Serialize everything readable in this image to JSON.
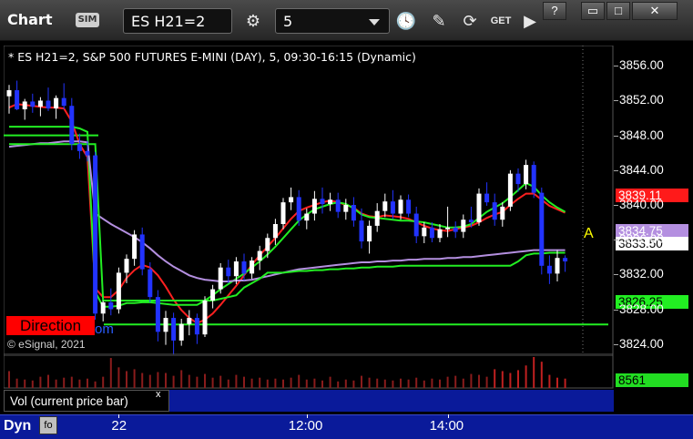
{
  "window": {
    "title": "Chart",
    "sim_badge": "SIM",
    "symbol": "ES H21=2",
    "interval": "5",
    "buttons": [
      "clock-icon",
      "pencil-icon",
      "study-icon",
      "get-icon",
      "play-icon",
      "question-icon",
      "restore-icon",
      "maximize-icon",
      "close-icon"
    ],
    "get_label": "GET"
  },
  "chart_info": "* ES H21=2, S&P 500 FUTURES E-MINI (DAY), 5, 09:30-16:15 (Dynamic)",
  "copyright": "© eSignal, 2021",
  "direction_label": "Direction",
  "direction_tail": "om",
  "marker_label": "A",
  "volume_pane": {
    "label": "Vol (current price bar)",
    "close": "x",
    "last": "8561"
  },
  "footer": {
    "mode": "Dyn",
    "icon_label": "fo"
  },
  "price_badges": {
    "red": "3839.11",
    "purple": "3834.75",
    "white": "3833.50",
    "green": "3826.25"
  },
  "colors": {
    "up_candle": "#ffffff",
    "down_candle": "#2233ff",
    "red_ma": "#ff2020",
    "green_ma": "#22ee22",
    "purple_ma": "#b48fe0",
    "support_line": "#22ee22",
    "volume": "#8a1c1c",
    "panel_blue": "#0a1a9a"
  },
  "chart_data": {
    "type": "candlestick",
    "y_ticks": [
      "3856.00",
      "3852.00",
      "3848.00",
      "3844.00",
      "3840.00",
      "3836.00",
      "3832.00",
      "3828.00",
      "3824.00"
    ],
    "ylim": [
      3822.5,
      3857.5
    ],
    "x_ticks": [
      "22",
      "12:00",
      "14:00"
    ],
    "x_tick_index": [
      14,
      38,
      56
    ],
    "candles": [
      [
        3852.5,
        3853.8,
        3850.5,
        3853.2
      ],
      [
        3853.2,
        3854.3,
        3850.9,
        3851.0
      ],
      [
        3851.0,
        3852.2,
        3849.8,
        3851.9
      ],
      [
        3851.9,
        3852.8,
        3850.6,
        3851.3
      ],
      [
        3851.3,
        3852.4,
        3850.2,
        3852.0
      ],
      [
        3852.0,
        3853.5,
        3850.8,
        3851.1
      ],
      [
        3851.1,
        3852.6,
        3849.9,
        3852.3
      ],
      [
        3852.3,
        3854.0,
        3851.0,
        3851.4
      ],
      [
        3851.4,
        3852.3,
        3846.3,
        3847.0
      ],
      [
        3847.0,
        3848.2,
        3845.3,
        3846.2
      ],
      [
        3846.2,
        3847.4,
        3845.0,
        3845.7
      ],
      [
        3845.7,
        3846.1,
        3826.8,
        3827.5
      ],
      [
        3827.5,
        3829.0,
        3826.6,
        3828.8
      ],
      [
        3828.8,
        3830.4,
        3827.3,
        3828.0
      ],
      [
        3828.0,
        3832.8,
        3827.5,
        3832.2
      ],
      [
        3832.2,
        3834.3,
        3831.0,
        3833.8
      ],
      [
        3833.8,
        3837.1,
        3833.0,
        3836.6
      ],
      [
        3836.6,
        3837.4,
        3831.9,
        3832.6
      ],
      [
        3832.6,
        3833.4,
        3828.8,
        3829.4
      ],
      [
        3829.4,
        3830.2,
        3824.3,
        3825.4
      ],
      [
        3825.4,
        3827.8,
        3823.9,
        3827.0
      ],
      [
        3827.0,
        3827.6,
        3822.8,
        3824.4
      ],
      [
        3824.4,
        3826.9,
        3823.8,
        3826.3
      ],
      [
        3826.3,
        3827.9,
        3825.0,
        3827.0
      ],
      [
        3827.0,
        3827.5,
        3824.0,
        3825.1
      ],
      [
        3825.1,
        3829.5,
        3824.8,
        3829.0
      ],
      [
        3829.0,
        3830.8,
        3828.1,
        3830.3
      ],
      [
        3830.3,
        3833.3,
        3829.8,
        3832.8
      ],
      [
        3832.8,
        3833.7,
        3831.0,
        3831.8
      ],
      [
        3831.8,
        3834.0,
        3830.9,
        3833.5
      ],
      [
        3833.5,
        3834.4,
        3831.3,
        3832.1
      ],
      [
        3832.1,
        3834.0,
        3831.5,
        3833.6
      ],
      [
        3833.6,
        3835.3,
        3832.5,
        3834.7
      ],
      [
        3834.7,
        3836.7,
        3833.9,
        3836.2
      ],
      [
        3836.2,
        3838.4,
        3835.4,
        3837.8
      ],
      [
        3837.8,
        3840.8,
        3837.2,
        3840.3
      ],
      [
        3840.3,
        3842.0,
        3839.4,
        3840.9
      ],
      [
        3840.9,
        3841.7,
        3837.6,
        3838.2
      ],
      [
        3838.2,
        3839.6,
        3837.2,
        3839.0
      ],
      [
        3839.0,
        3841.6,
        3838.2,
        3840.7
      ],
      [
        3840.7,
        3842.0,
        3839.0,
        3840.1
      ],
      [
        3840.1,
        3841.4,
        3839.3,
        3840.6
      ],
      [
        3840.6,
        3841.4,
        3838.5,
        3839.2
      ],
      [
        3839.2,
        3840.7,
        3838.3,
        3840.0
      ],
      [
        3840.0,
        3840.9,
        3837.5,
        3838.2
      ],
      [
        3838.2,
        3839.6,
        3835.0,
        3835.8
      ],
      [
        3835.8,
        3838.2,
        3834.4,
        3837.6
      ],
      [
        3837.6,
        3840.2,
        3836.9,
        3839.3
      ],
      [
        3839.3,
        3841.3,
        3838.6,
        3840.4
      ],
      [
        3840.4,
        3841.7,
        3838.4,
        3839.0
      ],
      [
        3839.0,
        3841.1,
        3838.3,
        3840.6
      ],
      [
        3840.6,
        3841.2,
        3838.6,
        3839.0
      ],
      [
        3839.0,
        3839.8,
        3835.6,
        3836.4
      ],
      [
        3836.4,
        3838.0,
        3835.6,
        3837.4
      ],
      [
        3837.4,
        3838.0,
        3835.7,
        3836.2
      ],
      [
        3836.2,
        3837.8,
        3835.7,
        3837.2
      ],
      [
        3837.2,
        3839.8,
        3836.3,
        3837.4
      ],
      [
        3837.4,
        3838.1,
        3836.2,
        3836.9
      ],
      [
        3836.9,
        3838.9,
        3836.2,
        3838.3
      ],
      [
        3838.3,
        3839.8,
        3837.4,
        3838.0
      ],
      [
        3838.0,
        3841.9,
        3837.6,
        3841.3
      ],
      [
        3841.3,
        3842.6,
        3839.9,
        3840.3
      ],
      [
        3840.3,
        3841.3,
        3837.6,
        3838.3
      ],
      [
        3838.3,
        3840.3,
        3837.5,
        3839.8
      ],
      [
        3839.8,
        3844.0,
        3839.3,
        3843.6
      ],
      [
        3843.6,
        3844.2,
        3841.5,
        3842.4
      ],
      [
        3842.4,
        3845.2,
        3841.8,
        3844.6
      ],
      [
        3844.6,
        3845.0,
        3840.8,
        3841.4
      ],
      [
        3841.4,
        3842.0,
        3832.0,
        3833.0
      ],
      [
        3833.0,
        3834.2,
        3830.9,
        3832.1
      ],
      [
        3832.1,
        3834.8,
        3831.2,
        3833.9
      ],
      [
        3833.9,
        3834.2,
        3832.3,
        3833.5
      ]
    ],
    "series": [
      {
        "role": "red",
        "values": [
          3851.2,
          3851.6,
          3851.5,
          3851.4,
          3851.3,
          3851.2,
          3851.2,
          3851.1,
          3849.6,
          3847.0,
          3845.5,
          3830.4,
          3829.4,
          3829.4,
          3830.2,
          3831.6,
          3832.5,
          3833.1,
          3832.8,
          3831.9,
          3830.6,
          3829.1,
          3827.9,
          3827.0,
          3826.4,
          3826.8,
          3827.5,
          3828.5,
          3829.6,
          3830.7,
          3831.9,
          3833.1,
          3834.2,
          3835.2,
          3836.2,
          3837.3,
          3838.4,
          3839.3,
          3839.7,
          3840.0,
          3840.3,
          3840.5,
          3840.3,
          3840.0,
          3839.7,
          3839.0,
          3838.7,
          3838.6,
          3838.8,
          3838.7,
          3838.6,
          3838.4,
          3838.0,
          3837.6,
          3837.3,
          3837.1,
          3837.0,
          3837.2,
          3837.4,
          3837.6,
          3838.0,
          3838.5,
          3838.9,
          3839.2,
          3840.0,
          3840.7,
          3841.3,
          3841.3,
          3840.6,
          3839.9,
          3839.5,
          3839.1
        ]
      },
      {
        "role": "green",
        "values": [
          3849.0,
          3849.0,
          3849.0,
          3849.0,
          3849.0,
          3849.0,
          3849.0,
          3849.0,
          3849.0,
          3848.8,
          3848.4,
          3830.0,
          3828.3,
          3828.3,
          3828.4,
          3828.7,
          3828.7,
          3828.8,
          3828.8,
          3828.7,
          3828.6,
          3828.5,
          3828.5,
          3828.5,
          3828.5,
          3829.0,
          3829.6,
          3830.3,
          3830.9,
          3831.5,
          3832.1,
          3832.8,
          3833.5,
          3834.3,
          3835.2,
          3836.2,
          3837.2,
          3838.2,
          3838.9,
          3839.5,
          3839.8,
          3840.1,
          3840.3,
          3840.1,
          3839.6,
          3838.9,
          3838.6,
          3838.5,
          3838.4,
          3838.3,
          3838.2,
          3838.2,
          3838.1,
          3838.0,
          3837.8,
          3837.6,
          3837.4,
          3837.4,
          3837.5,
          3837.8,
          3838.5,
          3839.2,
          3839.7,
          3840.2,
          3840.9,
          3841.7,
          3842.5,
          3842.1,
          3841.1,
          3840.3,
          3839.7,
          3839.2
        ]
      },
      {
        "role": "purple",
        "values": [
          3846.7,
          3846.8,
          3846.9,
          3847.0,
          3847.1,
          3847.1,
          3847.2,
          3847.3,
          3847.3,
          3847.3,
          3847.2,
          3839.0,
          3838.4,
          3837.8,
          3837.3,
          3836.8,
          3836.3,
          3835.7,
          3835.0,
          3834.2,
          3833.5,
          3832.9,
          3832.4,
          3831.9,
          3831.6,
          3831.4,
          3831.3,
          3831.2,
          3831.2,
          3831.3,
          3831.3,
          3831.4,
          3831.6,
          3831.8,
          3832.0,
          3832.2,
          3832.4,
          3832.6,
          3832.7,
          3832.8,
          3832.9,
          3833.0,
          3833.1,
          3833.2,
          3833.3,
          3833.4,
          3833.4,
          3833.5,
          3833.5,
          3833.6,
          3833.6,
          3833.7,
          3833.7,
          3833.8,
          3833.8,
          3833.8,
          3833.9,
          3833.9,
          3834.0,
          3834.0,
          3834.1,
          3834.2,
          3834.3,
          3834.4,
          3834.5,
          3834.6,
          3834.7,
          3834.8,
          3834.8,
          3834.8,
          3834.8,
          3834.8
        ]
      },
      {
        "role": "green-step",
        "values": [
          3847.0,
          3847.0,
          3847.0,
          3847.0,
          3847.0,
          3847.0,
          3847.0,
          3847.0,
          3847.0,
          3847.0,
          3847.0,
          3847.0,
          3829.0,
          3829.0,
          3829.0,
          3829.0,
          3829.0,
          3829.0,
          3829.0,
          3829.0,
          3829.0,
          3829.0,
          3829.0,
          3829.0,
          3829.0,
          3829.0,
          3829.0,
          3829.2,
          3829.4,
          3829.6,
          3830.5,
          3831.0,
          3831.5,
          3832.2,
          3832.2,
          3832.2,
          3832.3,
          3832.4,
          3832.4,
          3832.5,
          3832.5,
          3832.6,
          3832.6,
          3832.7,
          3832.7,
          3832.8,
          3832.8,
          3832.9,
          3832.9,
          3832.9,
          3833.0,
          3833.0,
          3833.0,
          3833.0,
          3833.0,
          3833.0,
          3833.0,
          3833.0,
          3833.0,
          3833.0,
          3833.0,
          3833.0,
          3833.0,
          3833.0,
          3833.0,
          3833.5,
          3834.2,
          3834.4,
          3834.4,
          3834.5,
          3834.5,
          3834.5
        ]
      }
    ],
    "support_levels": [
      3826.25,
      3848.0
    ],
    "volume": [
      18,
      10,
      9,
      8,
      12,
      14,
      9,
      11,
      12,
      9,
      10,
      7,
      12,
      32,
      22,
      18,
      20,
      16,
      14,
      17,
      16,
      13,
      19,
      14,
      12,
      15,
      11,
      13,
      9,
      14,
      12,
      10,
      11,
      9,
      10,
      9,
      11,
      14,
      9,
      10,
      8,
      12,
      7,
      9,
      8,
      13,
      11,
      10,
      9,
      8,
      10,
      9,
      11,
      8,
      10,
      9,
      12,
      13,
      10,
      15,
      14,
      12,
      20,
      18,
      16,
      19,
      24,
      33,
      28,
      14,
      11,
      10
    ]
  }
}
